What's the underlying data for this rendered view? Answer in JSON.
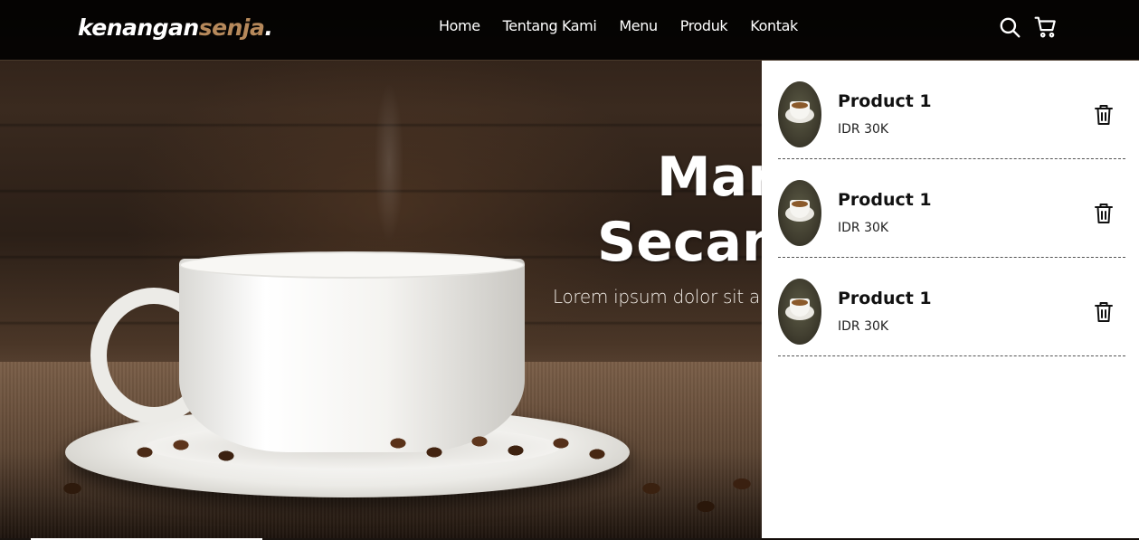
{
  "brand": {
    "part1": "kenangan",
    "part2": "senja",
    "part3": ".",
    "accent_color": "#b6895b"
  },
  "nav": {
    "items": [
      "Home",
      "Tentang Kami",
      "Menu",
      "Produk",
      "Kontak"
    ],
    "icons": [
      "search-icon",
      "cart-icon"
    ]
  },
  "hero": {
    "title_line1": "Mar",
    "title_line2": "Secan",
    "subtitle": "Lorem ipsum dolor sit am"
  },
  "cart": {
    "items": [
      {
        "name": "Product 1",
        "price": "IDR 30K",
        "action_icon": "trash-icon"
      },
      {
        "name": "Product 1",
        "price": "IDR 30K",
        "action_icon": "trash-icon"
      },
      {
        "name": "Product 1",
        "price": "IDR 30K",
        "action_icon": "trash-icon"
      }
    ]
  }
}
